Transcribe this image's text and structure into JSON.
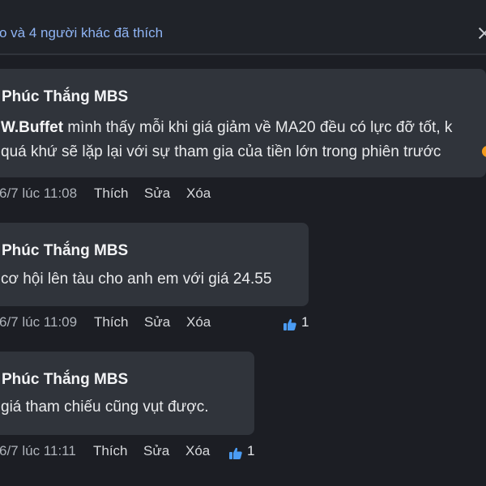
{
  "header": {
    "likes_summary": "o và 4 người khác đã thích"
  },
  "comments": [
    {
      "author": "Phúc Thắng MBS",
      "mention": "W.Buffet",
      "line1": " mình thấy mỗi khi giá giảm về MA20 đều có lực đỡ tốt, k",
      "line2": "quá khứ sẽ lặp lại với sự tham gia của tiền lớn trong phiên trước",
      "time": "6/7 lúc 11:08",
      "like_label": "Thích",
      "edit_label": "Sửa",
      "delete_label": "Xóa"
    },
    {
      "author": "Phúc Thắng MBS",
      "line1": "cơ hội lên tàu cho anh em với giá 24.55",
      "time": "6/7 lúc 11:09",
      "like_label": "Thích",
      "edit_label": "Sửa",
      "delete_label": "Xóa",
      "reaction_count": "1"
    },
    {
      "author": "Phúc Thắng MBS",
      "line1": "giá tham chiếu cũng vụt được.",
      "time": "6/7 lúc 11:11",
      "like_label": "Thích",
      "edit_label": "Sửa",
      "delete_label": "Xóa",
      "reaction_count": "1"
    }
  ],
  "icons": {
    "close": "close-icon",
    "like": "thumbs-up-icon",
    "emoji": "emoji-icon"
  },
  "colors": {
    "background": "#1c1e24",
    "bubble": "#30343b",
    "link": "#8fb4f4",
    "like_blue": "#4b9cf4",
    "emoji_orange": "#f39b1b"
  }
}
